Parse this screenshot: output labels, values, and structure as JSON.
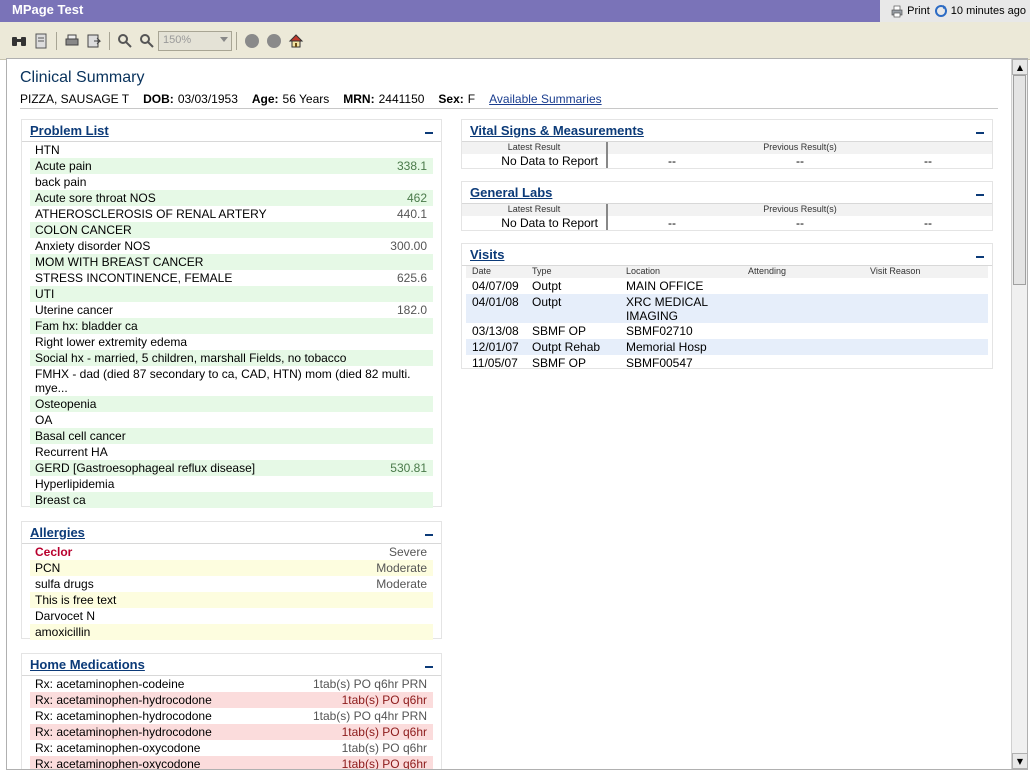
{
  "window": {
    "title": "MPage Test",
    "print_label": "Print",
    "refresh_label": "10 minutes ago"
  },
  "toolbar": {
    "zoom_value": "150%"
  },
  "page": {
    "title": "Clinical Summary",
    "patient_name": "PIZZA, SAUSAGE T",
    "dob_label": "DOB:",
    "dob_value": "03/03/1953",
    "age_label": "Age:",
    "age_value": "56 Years",
    "mrn_label": "MRN:",
    "mrn_value": "2441150",
    "sex_label": "Sex:",
    "sex_value": "F",
    "available_summaries": "Available Summaries"
  },
  "problem_list": {
    "title": "Problem List",
    "items": [
      {
        "name": "HTN",
        "code": ""
      },
      {
        "name": "Acute pain",
        "code": "338.1"
      },
      {
        "name": "back pain",
        "code": ""
      },
      {
        "name": "Acute sore throat NOS",
        "code": "462"
      },
      {
        "name": "ATHEROSCLEROSIS OF RENAL ARTERY",
        "code": "440.1"
      },
      {
        "name": "COLON CANCER",
        "code": ""
      },
      {
        "name": "Anxiety disorder NOS",
        "code": "300.00"
      },
      {
        "name": "MOM WITH BREAST CANCER",
        "code": ""
      },
      {
        "name": "STRESS INCONTINENCE, FEMALE",
        "code": "625.6"
      },
      {
        "name": "UTI",
        "code": ""
      },
      {
        "name": "Uterine cancer",
        "code": "182.0"
      },
      {
        "name": "Fam hx: bladder ca",
        "code": ""
      },
      {
        "name": "Right lower extremity edema",
        "code": ""
      },
      {
        "name": "Social hx - married, 5 children, marshall Fields, no tobacco",
        "code": ""
      },
      {
        "name": "FMHX - dad (died 87 secondary to ca, CAD, HTN) mom (died 82 multi. mye...",
        "code": ""
      },
      {
        "name": "Osteopenia",
        "code": ""
      },
      {
        "name": "OA",
        "code": ""
      },
      {
        "name": "Basal cell cancer",
        "code": ""
      },
      {
        "name": "Recurrent HA",
        "code": ""
      },
      {
        "name": "GERD [Gastroesophageal reflux disease]",
        "code": "530.81"
      },
      {
        "name": "Hyperlipidemia",
        "code": ""
      },
      {
        "name": "Breast ca",
        "code": ""
      }
    ]
  },
  "allergies": {
    "title": "Allergies",
    "items": [
      {
        "name": "Ceclor",
        "severity": "Severe"
      },
      {
        "name": "PCN",
        "severity": "Moderate"
      },
      {
        "name": "sulfa drugs",
        "severity": "Moderate"
      },
      {
        "name": "This is free text",
        "severity": ""
      },
      {
        "name": "Darvocet N",
        "severity": ""
      },
      {
        "name": "amoxicillin",
        "severity": ""
      }
    ]
  },
  "home_medications": {
    "title": "Home Medications",
    "items": [
      {
        "name": "Rx: acetaminophen-codeine",
        "dose": "1tab(s) PO q6hr PRN"
      },
      {
        "name": "Rx: acetaminophen-hydrocodone",
        "dose": "1tab(s) PO q6hr"
      },
      {
        "name": "Rx: acetaminophen-hydrocodone",
        "dose": "1tab(s) PO q4hr PRN"
      },
      {
        "name": "Rx: acetaminophen-hydrocodone",
        "dose": "1tab(s) PO q6hr"
      },
      {
        "name": "Rx: acetaminophen-oxycodone",
        "dose": "1tab(s) PO q6hr"
      },
      {
        "name": "Rx: acetaminophen-oxycodone",
        "dose": "1tab(s) PO q6hr"
      }
    ]
  },
  "vitals": {
    "title": "Vital Signs & Measurements",
    "latest_label": "Latest Result",
    "previous_label": "Previous Result(s)",
    "latest_value": "No Data to Report",
    "previous_values": [
      "--",
      "--",
      "--"
    ]
  },
  "labs": {
    "title": "General Labs",
    "latest_label": "Latest Result",
    "previous_label": "Previous Result(s)",
    "latest_value": "No Data to Report",
    "previous_values": [
      "--",
      "--",
      "--"
    ]
  },
  "visits": {
    "title": "Visits",
    "columns": [
      "Date",
      "Type",
      "Location",
      "Attending",
      "Visit Reason"
    ],
    "rows": [
      {
        "date": "04/07/09",
        "type": "Outpt",
        "location": "MAIN OFFICE",
        "attending": "",
        "reason": ""
      },
      {
        "date": "04/01/08",
        "type": "Outpt",
        "location": "XRC MEDICAL IMAGING",
        "attending": "",
        "reason": ""
      },
      {
        "date": "03/13/08",
        "type": "SBMF OP",
        "location": "SBMF02710",
        "attending": "",
        "reason": ""
      },
      {
        "date": "12/01/07",
        "type": "Outpt Rehab",
        "location": "Memorial Hosp",
        "attending": "",
        "reason": ""
      },
      {
        "date": "11/05/07",
        "type": "SBMF OP",
        "location": "SBMF00547",
        "attending": "",
        "reason": ""
      }
    ]
  }
}
